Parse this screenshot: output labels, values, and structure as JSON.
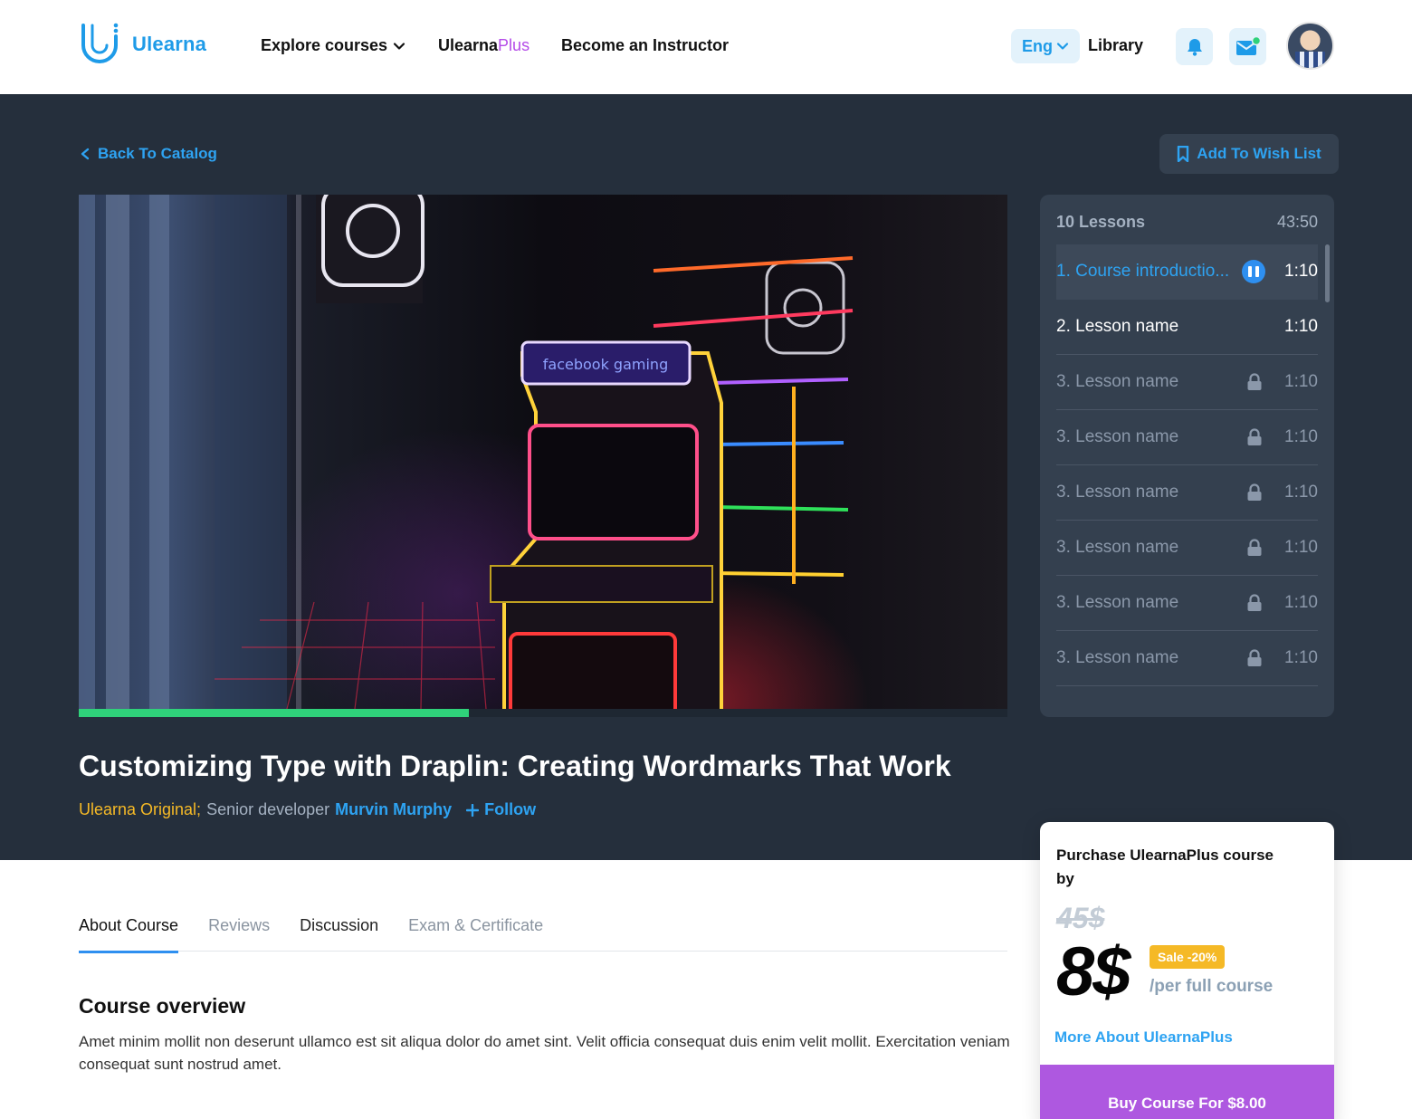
{
  "brand": {
    "name": "Ulearna"
  },
  "nav": {
    "explore": "Explore courses",
    "plus_base": "Ulearna",
    "plus_suffix": "Plus",
    "instructor": "Become an Instructor",
    "language": "Eng",
    "library": "Library"
  },
  "hero": {
    "back_label": "Back To Catalog",
    "wish_label": "Add To Wish List",
    "video_progress_fraction": 0.42,
    "course_title": "Customizing Type with Draplin: Creating Wordmarks That Work",
    "original_label": "Ulearna Original;",
    "role_label": "Senior developer",
    "author": "Murvin Murphy",
    "follow_label": "Follow"
  },
  "lessons": {
    "count_label": "10 Lessons",
    "total_duration": "43:50",
    "items": [
      {
        "name": "1. Course introductio...",
        "time": "1:10",
        "state": "playing"
      },
      {
        "name": "2. Lesson name",
        "time": "1:10",
        "state": "unlocked"
      },
      {
        "name": "3. Lesson name",
        "time": "1:10",
        "state": "locked"
      },
      {
        "name": "3. Lesson name",
        "time": "1:10",
        "state": "locked"
      },
      {
        "name": "3. Lesson name",
        "time": "1:10",
        "state": "locked"
      },
      {
        "name": "3. Lesson name",
        "time": "1:10",
        "state": "locked"
      },
      {
        "name": "3. Lesson name",
        "time": "1:10",
        "state": "locked"
      },
      {
        "name": "3. Lesson name",
        "time": "1:10",
        "state": "locked"
      }
    ]
  },
  "tabs": [
    {
      "label": "About Course",
      "active": true
    },
    {
      "label": "Reviews",
      "active": false
    },
    {
      "label": "Discussion",
      "active": false
    },
    {
      "label": "Exam & Certificate",
      "active": false
    }
  ],
  "overview": {
    "title": "Course overview",
    "text": "Amet minim mollit non deserunt ullamco est sit aliqua dolor do amet sint. Velit officia consequat duis enim velit mollit. Exercitation veniam consequat sunt nostrud amet."
  },
  "purchase": {
    "title": "Purchase UlearnaPlus course by",
    "old_price": "45$",
    "new_price": "8$",
    "sale_badge": "Sale -20%",
    "per_label": "/per full course",
    "more_link": "More About UlearnaPlus",
    "buy_label": "Buy Course For $8.00"
  },
  "colors": {
    "accent": "#2ea3f2",
    "plus": "#b44be8",
    "hero_bg": "#252f3c",
    "progress": "#2fd17a",
    "sale": "#f5b926",
    "buy": "#ae58e0"
  },
  "icons": [
    "ulearna-logo-icon",
    "chevron-down-icon",
    "bell-icon",
    "mail-icon",
    "avatar",
    "chevron-left-icon",
    "bookmark-icon",
    "pause-icon",
    "lock-icon",
    "plus-icon"
  ]
}
